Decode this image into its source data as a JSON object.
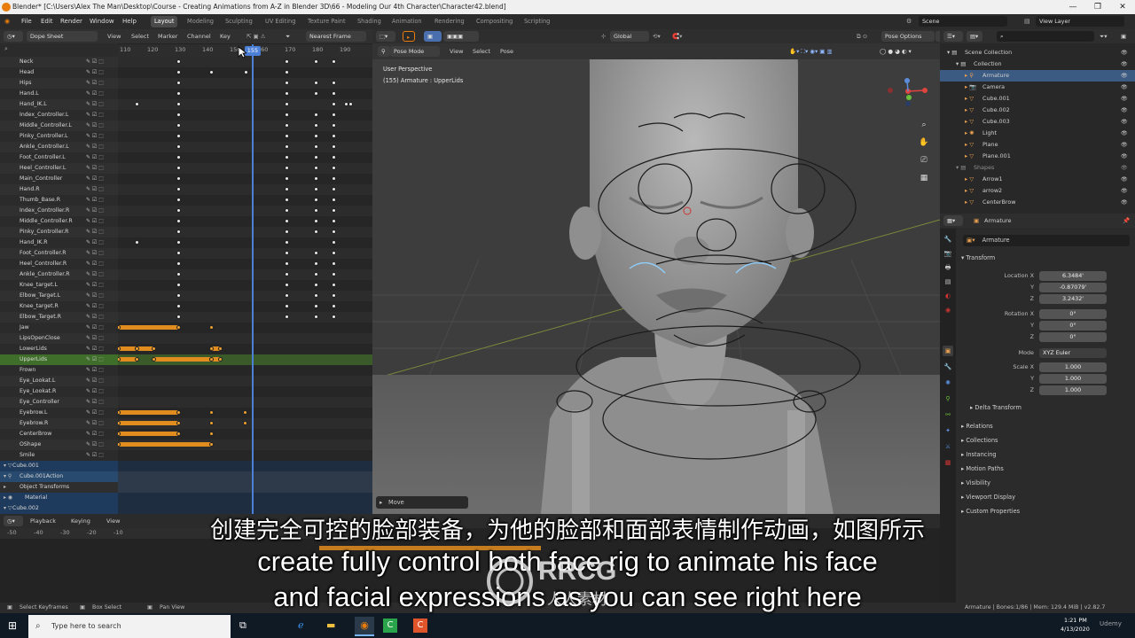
{
  "window": {
    "title": "Blender* [C:\\Users\\Alex The Man\\Desktop\\Course - Creating Animations from A-Z in Blender 3D\\66 - Modeling Our 4th Character\\Character42.blend]",
    "controls": [
      "—",
      "❐",
      "✕"
    ]
  },
  "menubar": {
    "items": [
      "File",
      "Edit",
      "Render",
      "Window",
      "Help"
    ],
    "workspaces": [
      "Layout",
      "Modeling",
      "Sculpting",
      "UV Editing",
      "Texture Paint",
      "Shading",
      "Animation",
      "Rendering",
      "Compositing",
      "Scripting"
    ],
    "active_workspace": "Layout",
    "scene": "Scene",
    "view_layer": "View Layer"
  },
  "dopesheet": {
    "mode": "Dope Sheet",
    "menus": [
      "View",
      "Select",
      "Marker",
      "Channel",
      "Key"
    ],
    "snap": "Nearest Frame",
    "ruler_ticks": [
      "110",
      "120",
      "130",
      "140",
      "150",
      "160",
      "170",
      "180",
      "190"
    ],
    "current_frame": "155",
    "channels": [
      {
        "name": "Neck",
        "type": "bone"
      },
      {
        "name": "Head",
        "type": "bone"
      },
      {
        "name": "Hips",
        "type": "bone"
      },
      {
        "name": "Hand.L",
        "type": "bone"
      },
      {
        "name": "Hand_IK.L",
        "type": "bone"
      },
      {
        "name": "Index_Controller.L",
        "type": "bone"
      },
      {
        "name": "Middle_Controller.L",
        "type": "bone"
      },
      {
        "name": "Pinky_Controller.L",
        "type": "bone"
      },
      {
        "name": "Ankle_Controller.L",
        "type": "bone"
      },
      {
        "name": "Foot_Controller.L",
        "type": "bone"
      },
      {
        "name": "Heel_Controller.L",
        "type": "bone"
      },
      {
        "name": "Main_Controller",
        "type": "bone"
      },
      {
        "name": "Hand.R",
        "type": "bone"
      },
      {
        "name": "Thumb_Base.R",
        "type": "bone"
      },
      {
        "name": "Index_Controller.R",
        "type": "bone"
      },
      {
        "name": "Middle_Controller.R",
        "type": "bone"
      },
      {
        "name": "Pinky_Controller.R",
        "type": "bone"
      },
      {
        "name": "Hand_IK.R",
        "type": "bone"
      },
      {
        "name": "Foot_Controller.R",
        "type": "bone"
      },
      {
        "name": "Heel_Controller.R",
        "type": "bone"
      },
      {
        "name": "Ankle_Controller.R",
        "type": "bone"
      },
      {
        "name": "Knee_target.L",
        "type": "bone"
      },
      {
        "name": "Elbow_Target.L",
        "type": "bone"
      },
      {
        "name": "Knee_target.R",
        "type": "bone"
      },
      {
        "name": "Elbow_Target.R",
        "type": "bone"
      },
      {
        "name": "Jaw",
        "type": "bone"
      },
      {
        "name": "LipsOpenClose",
        "type": "bone"
      },
      {
        "name": "LowerLids",
        "type": "bone"
      },
      {
        "name": "UpperLids",
        "type": "bone",
        "selected": true
      },
      {
        "name": "Frown",
        "type": "bone"
      },
      {
        "name": "Eye_Lookat.L",
        "type": "bone"
      },
      {
        "name": "Eye_Lookat.R",
        "type": "bone"
      },
      {
        "name": "Eye_Controller",
        "type": "bone"
      },
      {
        "name": "Eyebrow.L",
        "type": "bone"
      },
      {
        "name": "Eyebrow.R",
        "type": "bone"
      },
      {
        "name": "CenterBrow",
        "type": "bone"
      },
      {
        "name": "OShape",
        "type": "bone"
      },
      {
        "name": "Smile",
        "type": "bone"
      },
      {
        "name": "Cube.001",
        "type": "object"
      },
      {
        "name": "Cube.001Action",
        "type": "action"
      },
      {
        "name": "Object Transforms",
        "type": "group"
      },
      {
        "name": "Material",
        "type": "material"
      },
      {
        "name": "Cube.002",
        "type": "object"
      }
    ]
  },
  "viewport": {
    "mode": "Pose Mode",
    "menus": [
      "View",
      "Select",
      "Pose"
    ],
    "orientation": "Global",
    "options": "Pose Options",
    "info_line1": "User Perspective",
    "info_line2": "(155) Armature : UpperLids",
    "operator": "Move"
  },
  "outliner": {
    "search_placeholder": "",
    "items": [
      {
        "name": "Scene Collection",
        "depth": 0
      },
      {
        "name": "Collection",
        "depth": 1
      },
      {
        "name": "Armature",
        "depth": 2,
        "selected": true
      },
      {
        "name": "Camera",
        "depth": 2
      },
      {
        "name": "Cube.001",
        "depth": 2
      },
      {
        "name": "Cube.002",
        "depth": 2
      },
      {
        "name": "Cube.003",
        "depth": 2
      },
      {
        "name": "Light",
        "depth": 2
      },
      {
        "name": "Plane",
        "depth": 2
      },
      {
        "name": "Plane.001",
        "depth": 2
      },
      {
        "name": "Shapes",
        "depth": 1
      },
      {
        "name": "Arrow1",
        "depth": 2
      },
      {
        "name": "arrow2",
        "depth": 2
      },
      {
        "name": "CenterBrow",
        "depth": 2
      }
    ]
  },
  "properties": {
    "object_name": "Armature",
    "data_name": "Armature",
    "section_transform": "Transform",
    "location_label": "Location X",
    "location": [
      "6.3484'",
      "-0.87079'",
      "3.2432'"
    ],
    "rotation_label": "Rotation X",
    "rotation": [
      "0°",
      "0°",
      "0°"
    ],
    "mode_label": "Mode",
    "mode_value": "XYZ Euler",
    "scale_label": "Scale X",
    "scale": [
      "1.000",
      "1.000",
      "1.000"
    ],
    "axis_y": "Y",
    "axis_z": "Z",
    "subsections": [
      "Delta Transform",
      "Relations",
      "Collections",
      "Instancing",
      "Motion Paths",
      "Visibility",
      "Viewport Display",
      "Custom Properties"
    ]
  },
  "timeline": {
    "menus": [
      "Playback",
      "Keying",
      "View"
    ],
    "ticks": [
      "-50",
      "-40",
      "-30",
      "-20",
      "-10"
    ]
  },
  "statusbar": {
    "left": [
      "Select Keyframes",
      "Box Select",
      "Pan View"
    ],
    "right": "Armature | Bones:1/86 | Mem: 129.4 MiB | v2.82.7"
  },
  "taskbar": {
    "search_placeholder": "Type here to search",
    "time": "1:21 PM",
    "date": "4/13/2020"
  },
  "subtitles": {
    "cn": "创建完全可控的脸部装备，为他的脸部和面部表情制作动画，如图所示",
    "en1": "create fully control both face rig to animate his face",
    "en2": "and facial expressions as you can see right here"
  },
  "watermark": {
    "brand": "RRCG",
    "sub": "人人素材",
    "udemy": "Udemy"
  },
  "colors": {
    "accent_blue": "#4c7fd6",
    "key_orange": "#e08c1e",
    "selected_row": "#3f6e2a"
  }
}
